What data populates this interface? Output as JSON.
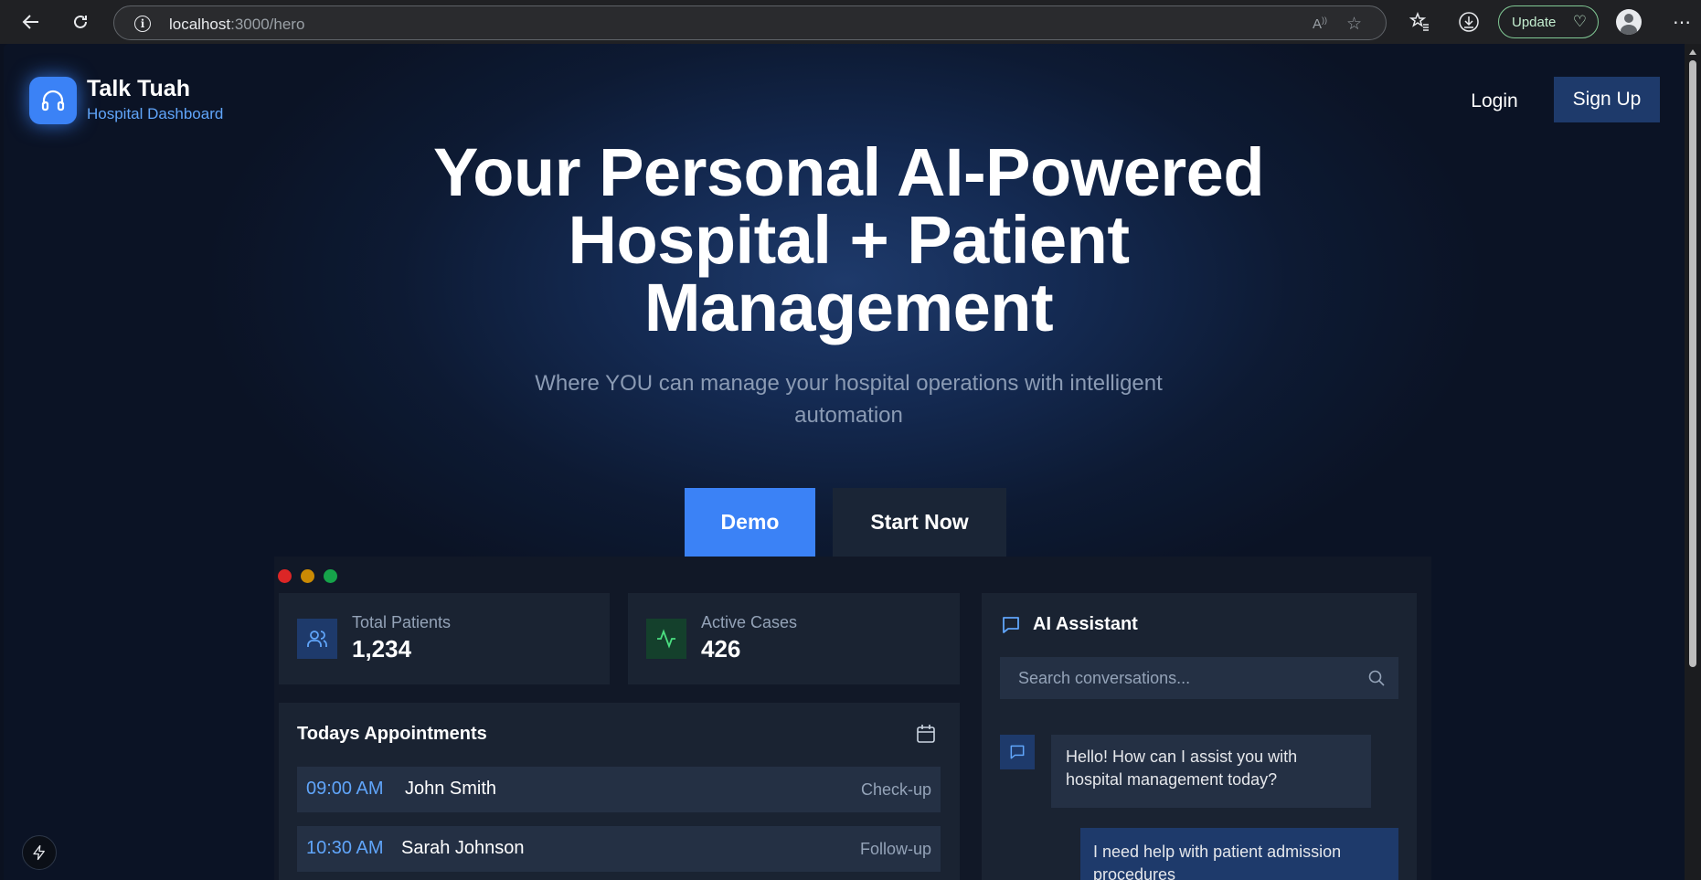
{
  "browser": {
    "url_host": "localhost",
    "url_path": ":3000/hero",
    "update_label": "Update"
  },
  "header": {
    "brand_title": "Talk Tuah",
    "brand_subtitle": "Hospital Dashboard",
    "login_label": "Login",
    "signup_label": "Sign Up"
  },
  "hero": {
    "title_line1": "Your Personal AI-Powered",
    "title_line2": "Hospital + Patient",
    "title_line3": "Management",
    "subtitle_line1": "Where YOU can manage your hospital operations with intelligent",
    "subtitle_line2": "automation",
    "demo_label": "Demo",
    "start_label": "Start Now"
  },
  "dashboard": {
    "window_dots": [
      "#dc2626",
      "#ca8a04",
      "#16a34a"
    ],
    "stats": [
      {
        "label": "Total Patients",
        "value": "1,234",
        "icon": "users-icon"
      },
      {
        "label": "Active Cases",
        "value": "426",
        "icon": "activity-icon"
      }
    ],
    "appointments": {
      "title": "Todays Appointments",
      "rows": [
        {
          "time": "09:00 AM",
          "name": "John Smith",
          "type": "Check-up"
        },
        {
          "time": "10:30 AM",
          "name": "Sarah Johnson",
          "type": "Follow-up"
        }
      ]
    },
    "assistant": {
      "title": "AI Assistant",
      "search_placeholder": "Search conversations...",
      "bot_message_line1": "Hello! How can I assist you with",
      "bot_message_line2": "hospital management today?",
      "user_message_line1": "I need help with patient admission",
      "user_message_line2": "procedures"
    }
  },
  "colors": {
    "accent": "#3b82f6",
    "accent_light": "#60a5fa",
    "card_bg": "#1a2332",
    "page_bg": "#0b1325"
  }
}
